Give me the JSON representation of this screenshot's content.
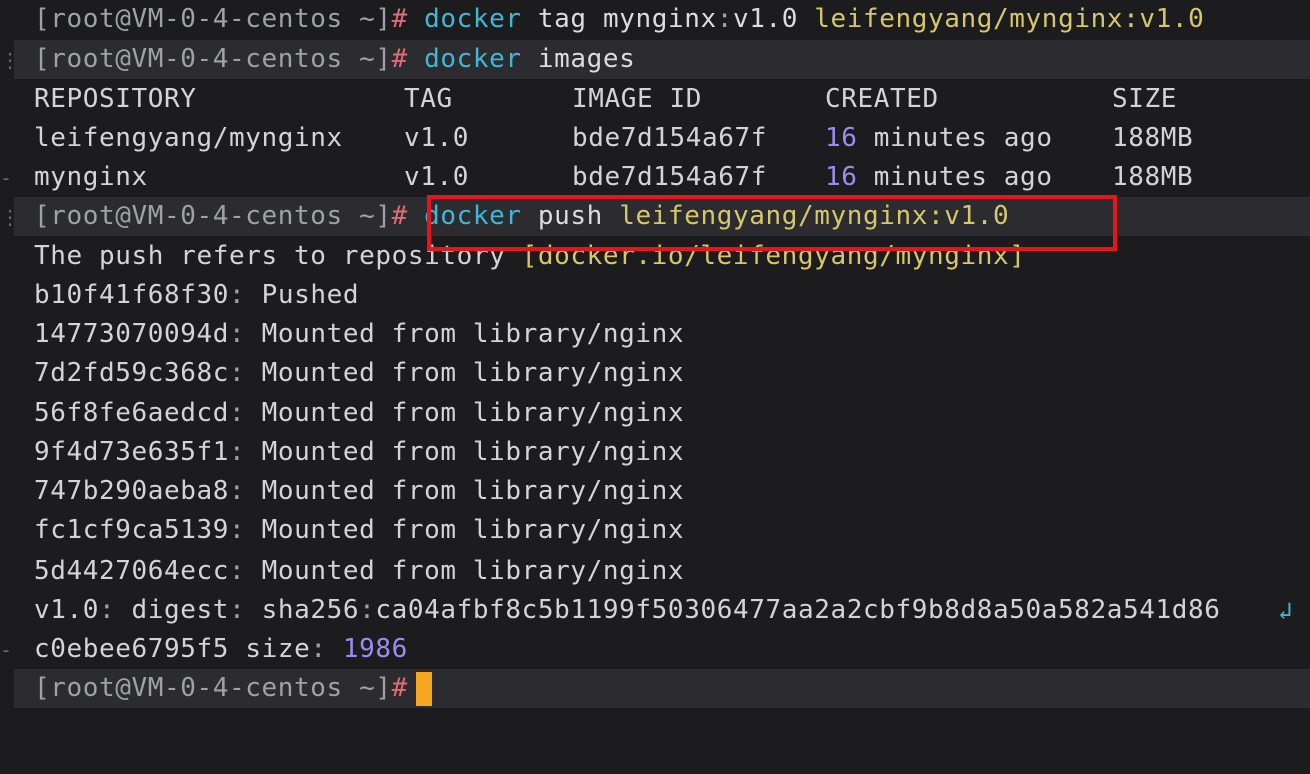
{
  "terminal": {
    "prompt": "[root@VM-0-4-centos ~]",
    "hash": "#",
    "line1": {
      "cmd": "docker",
      "sub": "tag",
      "arg": "mynginx",
      "colon": ":",
      "tag": "v1.0",
      "target": "leifengyang/mynginx:v1.0"
    },
    "line2": {
      "cmd": "docker",
      "sub": "images"
    },
    "images_table": {
      "headers": [
        "REPOSITORY",
        "TAG",
        "IMAGE ID",
        "CREATED",
        "SIZE"
      ],
      "rows": [
        {
          "repository": "leifengyang/mynginx",
          "tag": "v1.0",
          "image_id": "bde7d154a67f",
          "created_num": "16",
          "created_rest": "minutes ago",
          "size": "188MB"
        },
        {
          "repository": "mynginx",
          "tag": "v1.0",
          "image_id": "bde7d154a67f",
          "created_num": "16",
          "created_rest": "minutes ago",
          "size": "188MB"
        }
      ]
    },
    "push_cmd": {
      "cmd": "docker",
      "sub": "push",
      "target": "leifengyang/mynginx:v1.0"
    },
    "push_output": {
      "refers_text": "The push refers to repository",
      "refers_repo": "[docker.io/leifengyang/mynginx]",
      "layers": [
        {
          "id": "b10f41f68f30",
          "status": "Pushed"
        },
        {
          "id": "14773070094d",
          "status": "Mounted from library/nginx"
        },
        {
          "id": "7d2fd59c368c",
          "status": "Mounted from library/nginx"
        },
        {
          "id": "56f8fe6aedcd",
          "status": "Mounted from library/nginx"
        },
        {
          "id": "9f4d73e635f1",
          "status": "Mounted from library/nginx"
        },
        {
          "id": "747b290aeba8",
          "status": "Mounted from library/nginx"
        },
        {
          "id": "fc1cf9ca5139",
          "status": "Mounted from library/nginx"
        },
        {
          "id": "5d4427064ecc",
          "status": "Mounted from library/nginx"
        }
      ],
      "digest_tag": "v1.0",
      "digest_label": "digest",
      "digest_algo": "sha256",
      "digest_part1": "ca04afbf8c5b1199f50306477aa2a2cbf9b8d8a50a582a541d86",
      "digest_part2": "c0ebee6795f5",
      "size_label": "size",
      "size_value": "1986"
    },
    "wrap_icon": "wrap-arrow-icon",
    "colors": {
      "background": "#1c1c1e",
      "command": "#3fb7d6",
      "tag_value": "#d8c76a",
      "number": "#9d8cf0",
      "hash": "#e06c75",
      "cursor": "#f6a821",
      "highlight": "#e8141c"
    }
  }
}
